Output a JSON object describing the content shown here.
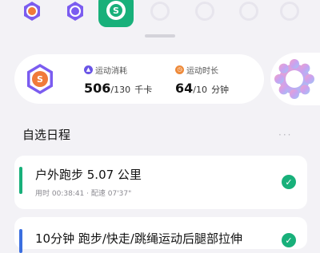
{
  "badges": {
    "letter": "S",
    "selected_index": 2
  },
  "stats": {
    "calories": {
      "label": "运动消耗",
      "value": "506",
      "goal": "/130",
      "unit": "千卡",
      "icon": "flame-icon",
      "color": "#6a55e6"
    },
    "duration": {
      "label": "运动时长",
      "value": "64",
      "goal": "/10",
      "unit": "分钟",
      "icon": "clock-icon",
      "color": "#ee8a3a"
    }
  },
  "section": {
    "title": "自选日程",
    "more": "···"
  },
  "schedule": [
    {
      "title": "户外跑步 5.07 公里",
      "meta": "用时 00:38:41 · 配速 07'37\"",
      "done": true,
      "accent": "#18b07a"
    },
    {
      "title": "10分钟 跑步/快走/跳绳运动后腿部拉伸",
      "done": true,
      "accent": "#3b6fe0"
    }
  ],
  "colors": {
    "brand_green": "#18b07a",
    "purple": "#6a55e6",
    "orange": "#ee8a3a",
    "background": "#f3f2f6"
  }
}
